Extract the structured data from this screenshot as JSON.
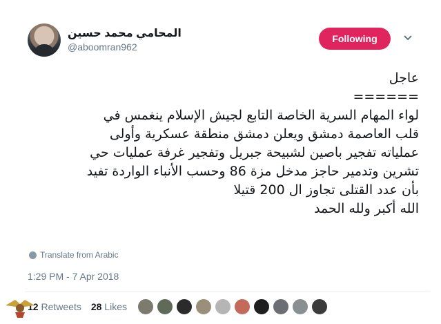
{
  "user": {
    "display_name": "المحامي محمد حسين",
    "handle": "@aboomran962"
  },
  "follow_button": {
    "label": "Following",
    "color": "#e0245e"
  },
  "tweet": {
    "lines": [
      "عاجل",
      "======",
      "لواء المهام السرية الخاصة التابع لجيش الإسلام ينغمس في",
      "قلب العاصمة دمشق ويعلن دمشق منطقة عسكرية وأولى",
      "عملياته تفجير باصين لشبيحة جبريل وتفجير غرفة عمليات حي",
      "تشرين وتدمير حاجز مدخل مزة 86 وحسب الأنباء الواردة تفيد",
      "بأن عدد القتلى تجاوز ال 200 قتيلا",
      "الله أكبر ولله الحمد"
    ]
  },
  "translate_label": "Translate from Arabic",
  "timestamp": "1:29 PM - 7 Apr 2018",
  "stats": {
    "retweets_count": "12",
    "retweets_label": "Retweets",
    "likes_count": "28",
    "likes_label": "Likes"
  },
  "liker_colors": [
    "#7d7a6e",
    "#5f6a58",
    "#2b2b2b",
    "#9a8f7a",
    "#b5b5b5",
    "#c46a5a",
    "#1e1e1e",
    "#6b6f73",
    "#8a8f92",
    "#3b3b3b"
  ],
  "icons": {
    "translate": "globe-icon",
    "menu": "chevron-down-icon"
  }
}
